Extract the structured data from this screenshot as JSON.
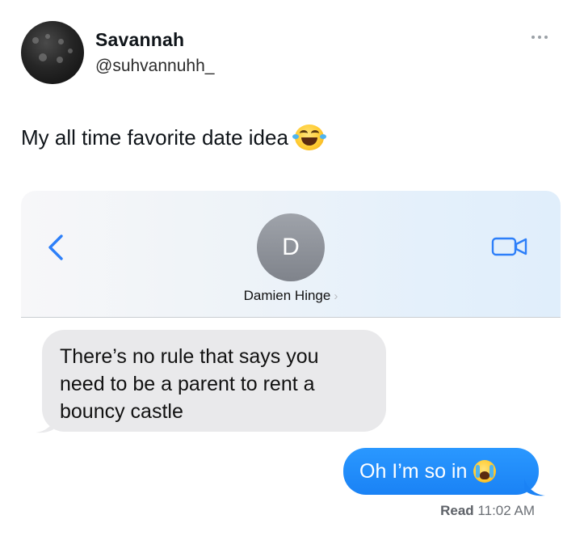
{
  "tweet": {
    "author_name": "Savannah",
    "author_handle": "@suhvannuhh_",
    "text": "My all time favorite date idea",
    "text_emoji": "face-with-tears-of-joy"
  },
  "imessage": {
    "contact_initial": "D",
    "contact_name": "Damien Hinge",
    "contact_chevron": "›",
    "incoming_lines": [
      "There’s no rule that says you",
      "need to be a parent to rent a",
      "bouncy castle"
    ],
    "outgoing_text": "Oh I’m so in",
    "outgoing_emoji": "loudly-crying-face",
    "read_label": "Read",
    "read_time": "11:02 AM"
  },
  "colors": {
    "imessage_blue": "#1a82f5",
    "incoming_gray": "#e9e9eb",
    "ios_link_blue": "#2d7ff9"
  }
}
